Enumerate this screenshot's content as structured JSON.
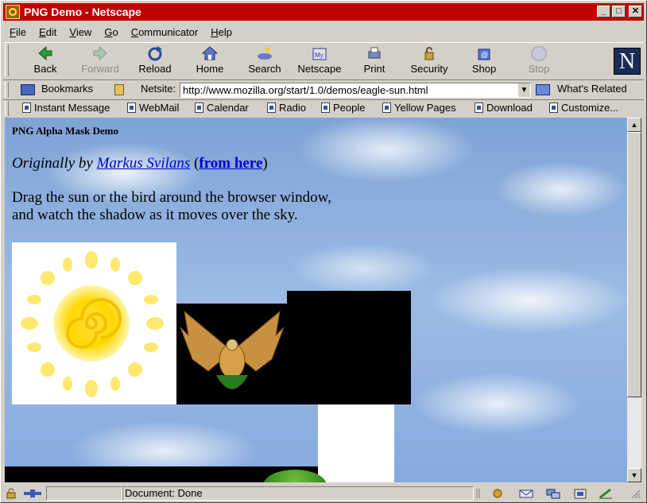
{
  "window": {
    "title": "PNG Demo - Netscape"
  },
  "menu": [
    {
      "key": "F",
      "rest": "ile"
    },
    {
      "key": "E",
      "rest": "dit"
    },
    {
      "key": "V",
      "rest": "iew"
    },
    {
      "key": "G",
      "rest": "o"
    },
    {
      "key": "C",
      "rest": "ommunicator"
    },
    {
      "key": "H",
      "rest": "elp"
    }
  ],
  "toolbar": {
    "back": "Back",
    "forward": "Forward",
    "reload": "Reload",
    "home": "Home",
    "search": "Search",
    "netscape": "Netscape",
    "print": "Print",
    "security": "Security",
    "shop": "Shop",
    "stop": "Stop",
    "logo": "N"
  },
  "location": {
    "bookmarks": "Bookmarks",
    "netsite_label": "Netsite:",
    "url": "http://www.mozilla.org/start/1.0/demos/eagle-sun.html",
    "whats_related": "What's Related"
  },
  "personal": {
    "instant_message": "Instant Message",
    "webmail": "WebMail",
    "calendar": "Calendar",
    "radio": "Radio",
    "people": "People",
    "yellow_pages": "Yellow Pages",
    "download": "Download",
    "customize": "Customize..."
  },
  "page": {
    "heading": "PNG Alpha Mask Demo",
    "byline_prefix": "Originally by",
    "author": "Markus Svilans",
    "from_here": "from here",
    "desc_line1": "Drag the sun or the bird around the browser window,",
    "desc_line2": "and watch the shadow as it moves over the sky."
  },
  "status": {
    "text": "Document: Done"
  },
  "colors": {
    "titlebar": "#c00000",
    "link": "#0000cc"
  }
}
